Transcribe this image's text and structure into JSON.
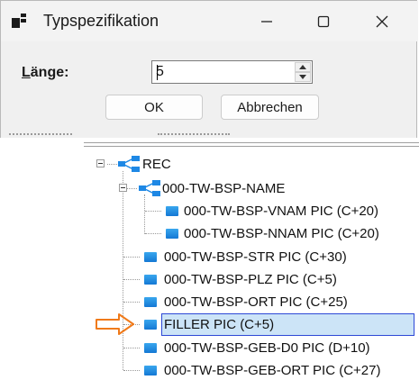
{
  "dialog": {
    "title": "Typspezifikation",
    "length_label_accel": "L",
    "length_label_rest": "änge:",
    "length_value": "5",
    "ok_label": "OK",
    "cancel_label": "Abbrechen"
  },
  "tree": {
    "root": "REC",
    "group": "000-TW-BSP-NAME",
    "group_children": [
      "000-TW-BSP-VNAM PIC (C+20)",
      "000-TW-BSP-NNAM PIC (C+20)"
    ],
    "items": [
      "000-TW-BSP-STR PIC (C+30)",
      "000-TW-BSP-PLZ PIC (C+5)",
      "000-TW-BSP-ORT PIC (C+25)",
      "FILLER PIC (C+5)",
      "000-TW-BSP-GEB-D0 PIC (D+10)",
      "000-TW-BSP-GEB-ORT PIC (C+27)"
    ],
    "selected_index": 3
  },
  "colors": {
    "selection_fill": "#cce4f7",
    "selection_border": "#2d48d6",
    "arrow": "#f07a1a",
    "icon_blue": "#1e88e5"
  }
}
